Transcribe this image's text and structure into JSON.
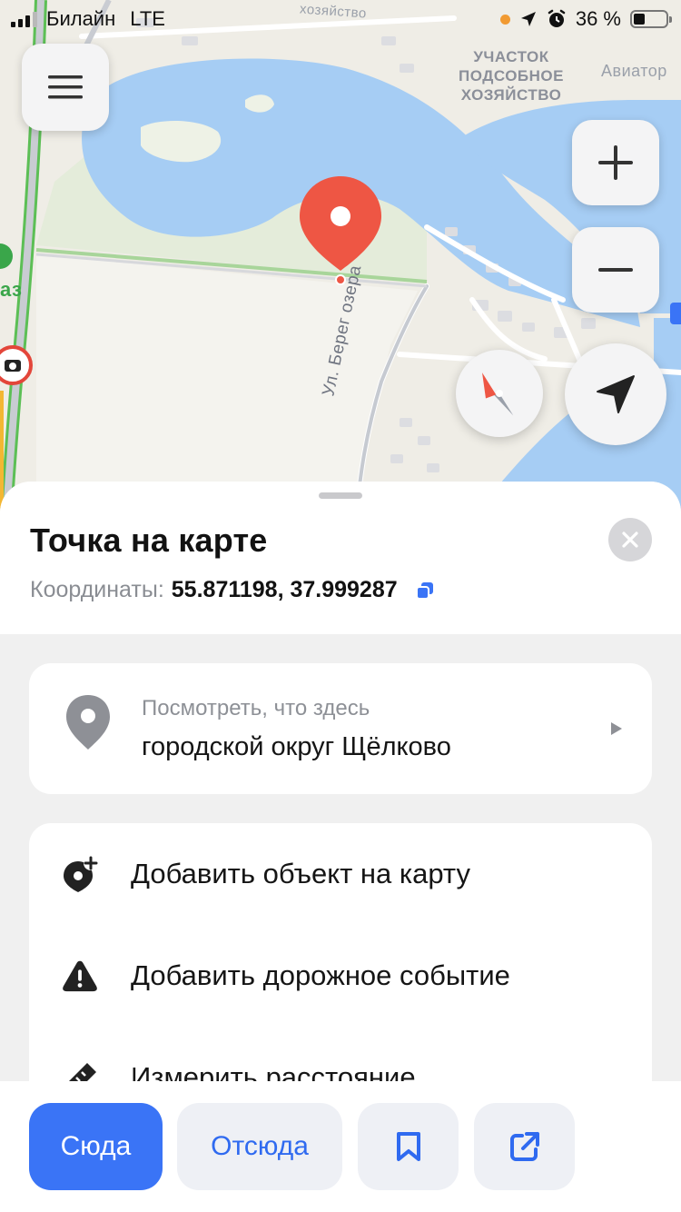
{
  "status_bar": {
    "carrier": "Билайн",
    "network": "LTE",
    "battery": "36 %",
    "battery_level": 0.36
  },
  "map": {
    "labels": {
      "plot_1": "УЧАСТОК",
      "plot_2": "ПОДСОБНОЕ",
      "plot_3": "ХОЗЯЙСТВО",
      "aviator": "Авиатор",
      "top_road": "хозяйство",
      "street": "Ул. Берег озера",
      "edge": "аз"
    },
    "colors": {
      "water": "#a6cdf4",
      "land": "#efede6",
      "park": "#e3ecd9",
      "pin": "#ee5644"
    }
  },
  "sheet": {
    "title": "Точка на карте",
    "coords_label": "Координаты:",
    "coords_value": "55.871198, 37.999287",
    "whats_here": {
      "subtitle": "Посмотреть, что здесь",
      "title": "городской округ Щёлково"
    },
    "actions": [
      {
        "label": "Добавить объект на карту",
        "icon": "add-place-icon"
      },
      {
        "label": "Добавить дорожное событие",
        "icon": "warning-icon"
      },
      {
        "label": "Измерить расстояние",
        "icon": "ruler-icon"
      }
    ]
  },
  "bottom_bar": {
    "here": "Сюда",
    "from": "Отсюда",
    "bookmark_icon": "bookmark-icon",
    "share_icon": "share-icon",
    "accent": "#3a74f6"
  }
}
